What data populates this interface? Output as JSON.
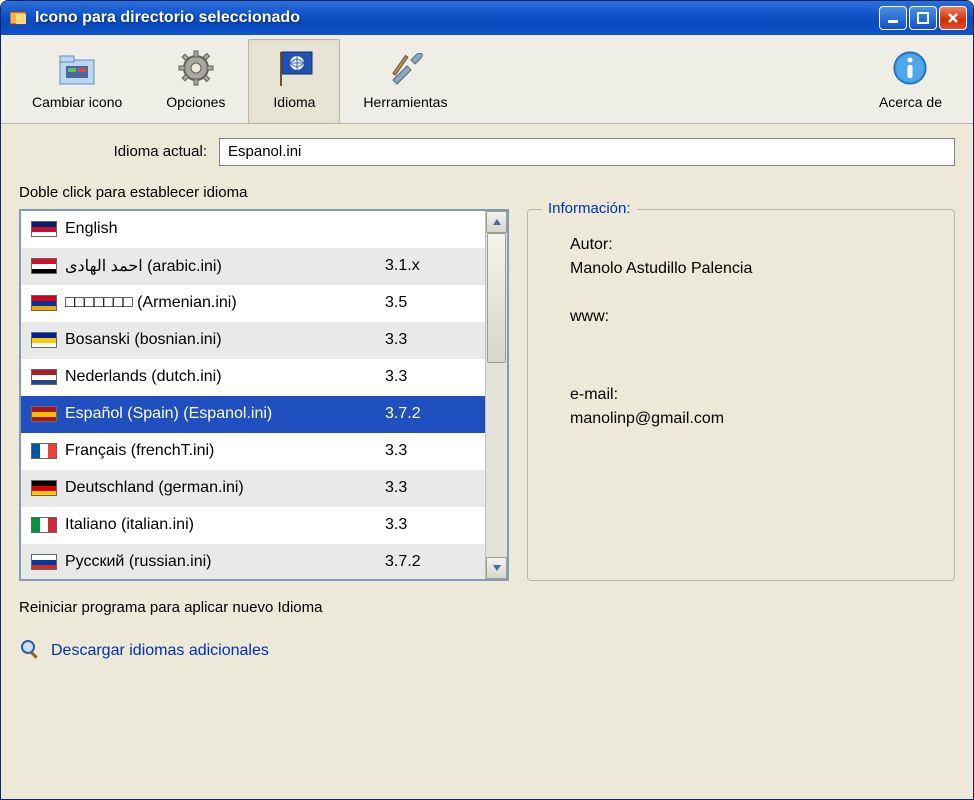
{
  "window_title": "Icono para directorio seleccionado",
  "toolbar": {
    "change_icon": "Cambiar icono",
    "options": "Opciones",
    "language": "Idioma",
    "tools": "Herramientas",
    "about": "Acerca de"
  },
  "current_language_label": "Idioma actual:",
  "current_language_value": "Espanol.ini",
  "list_instruction": "Doble click para establecer idioma",
  "languages": [
    {
      "name": "English",
      "version": ""
    },
    {
      "name": "احمد الهادى   (arabic.ini)",
      "version": "3.1.x"
    },
    {
      "name": "□□□□□□□   (Armenian.ini)",
      "version": "3.5"
    },
    {
      "name": "Bosanski   (bosnian.ini)",
      "version": "3.3"
    },
    {
      "name": "Nederlands   (dutch.ini)",
      "version": "3.3"
    },
    {
      "name": "Español (Spain)   (Espanol.ini)",
      "version": "3.7.2"
    },
    {
      "name": "Français   (frenchT.ini)",
      "version": "3.3"
    },
    {
      "name": "Deutschland   (german.ini)",
      "version": "3.3"
    },
    {
      "name": "Italiano   (italian.ini)",
      "version": "3.3"
    },
    {
      "name": "Русский   (russian.ini)",
      "version": "3.7.2"
    }
  ],
  "selected_index": 5,
  "info": {
    "legend": "Información:",
    "author_label": "Autor:",
    "author_value": "Manolo Astudillo Palencia",
    "www_label": "www:",
    "www_value": "",
    "email_label": "e-mail:",
    "email_value": "manolinp@gmail.com"
  },
  "restart_note": "Reiniciar programa para aplicar nuevo Idioma",
  "download_link": "Descargar idiomas adicionales"
}
